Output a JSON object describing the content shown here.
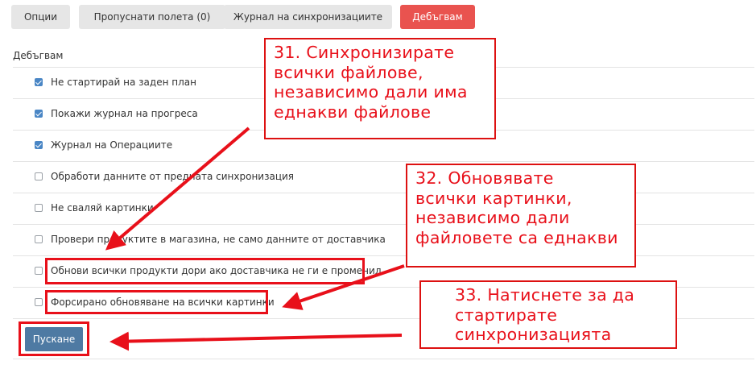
{
  "tabs": [
    {
      "label": "Опции",
      "active": false
    },
    {
      "label": "Пропуснати полета (0)",
      "active": false
    },
    {
      "label": "Журнал на синхронизациите",
      "active": false
    },
    {
      "label": "Дебъгвам",
      "active": true
    }
  ],
  "section_title": "Дебъгвам",
  "options": [
    {
      "label": "Не стартирай на заден план",
      "checked": true
    },
    {
      "label": "Покажи журнал на прогреса",
      "checked": true
    },
    {
      "label": "Журнал на Операциите",
      "checked": true
    },
    {
      "label": "Обработи данните от предната синхронизация",
      "checked": false
    },
    {
      "label": "Не сваляй картинки",
      "checked": false
    },
    {
      "label": "Провери продуктите в магазина, не само данните от доставчика",
      "checked": false
    },
    {
      "label": "Обнови всички продукти дори ако доставчика не ги е променил",
      "checked": false
    },
    {
      "label": "Форсирано обновяване на всички картинки",
      "checked": false
    }
  ],
  "start_button": "Пускане",
  "callouts": [
    {
      "lines": [
        "31. Синхронизирате",
        "всички файлове,",
        "независимо дали има",
        "еднакви файлове"
      ]
    },
    {
      "lines": [
        "32. Обновявате",
        "всички картинки,",
        "независимо дали",
        "файловете са еднакви"
      ]
    },
    {
      "lines": [
        "33. Натиснете за да",
        "стартирате",
        "синхронизацията"
      ]
    }
  ],
  "colors": {
    "annotation_red": "#e8101a",
    "active_tab": "#e9534f",
    "start_button": "#4e7aa3",
    "checkbox_checked": "#4a86c5"
  }
}
